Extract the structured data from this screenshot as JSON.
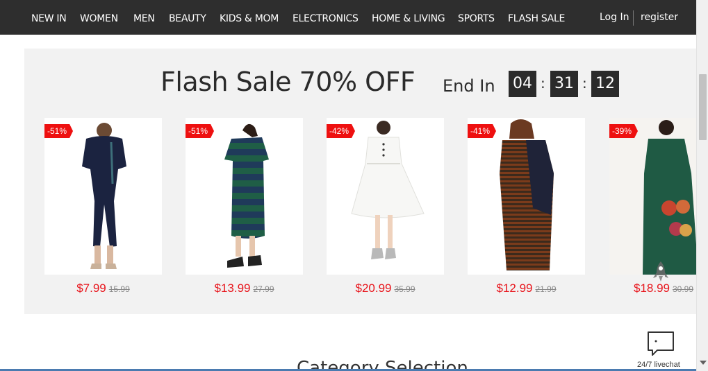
{
  "nav": {
    "items": [
      "NEW IN",
      "WOMEN",
      "MEN",
      "BEAUTY",
      "KIDS & MOM",
      "ELECTRONICS",
      "HOME & LIVING",
      "SPORTS",
      "FLASH SALE"
    ],
    "login": "Log In",
    "register": "register"
  },
  "flash": {
    "title": "Flash Sale 70% OFF",
    "end_in": "End In",
    "timer": {
      "hours": "04",
      "minutes": "31",
      "seconds": "12",
      "sep": ":"
    }
  },
  "products": [
    {
      "badge": "-51%",
      "price": "$7.99",
      "old_price": "15.99",
      "icon": "navy-jumpsuit-image"
    },
    {
      "badge": "-51%",
      "price": "$13.99",
      "old_price": "27.99",
      "icon": "striped-dress-image"
    },
    {
      "badge": "-42%",
      "price": "$20.99",
      "old_price": "35.99",
      "icon": "white-dress-image"
    },
    {
      "badge": "-41%",
      "price": "$12.99",
      "old_price": "21.99",
      "icon": "brown-striped-maxi-image"
    },
    {
      "badge": "-39%",
      "price": "$18.99",
      "old_price": "30.99",
      "icon": "green-dress-image"
    }
  ],
  "livechat": {
    "label": "24/7 livechat"
  },
  "category": {
    "heading": "Category Selection"
  },
  "colors": {
    "nav_bg": "#2e2e2e",
    "badge": "#ee1010",
    "price": "#e8141b",
    "panel_bg": "#f2f2f2"
  }
}
